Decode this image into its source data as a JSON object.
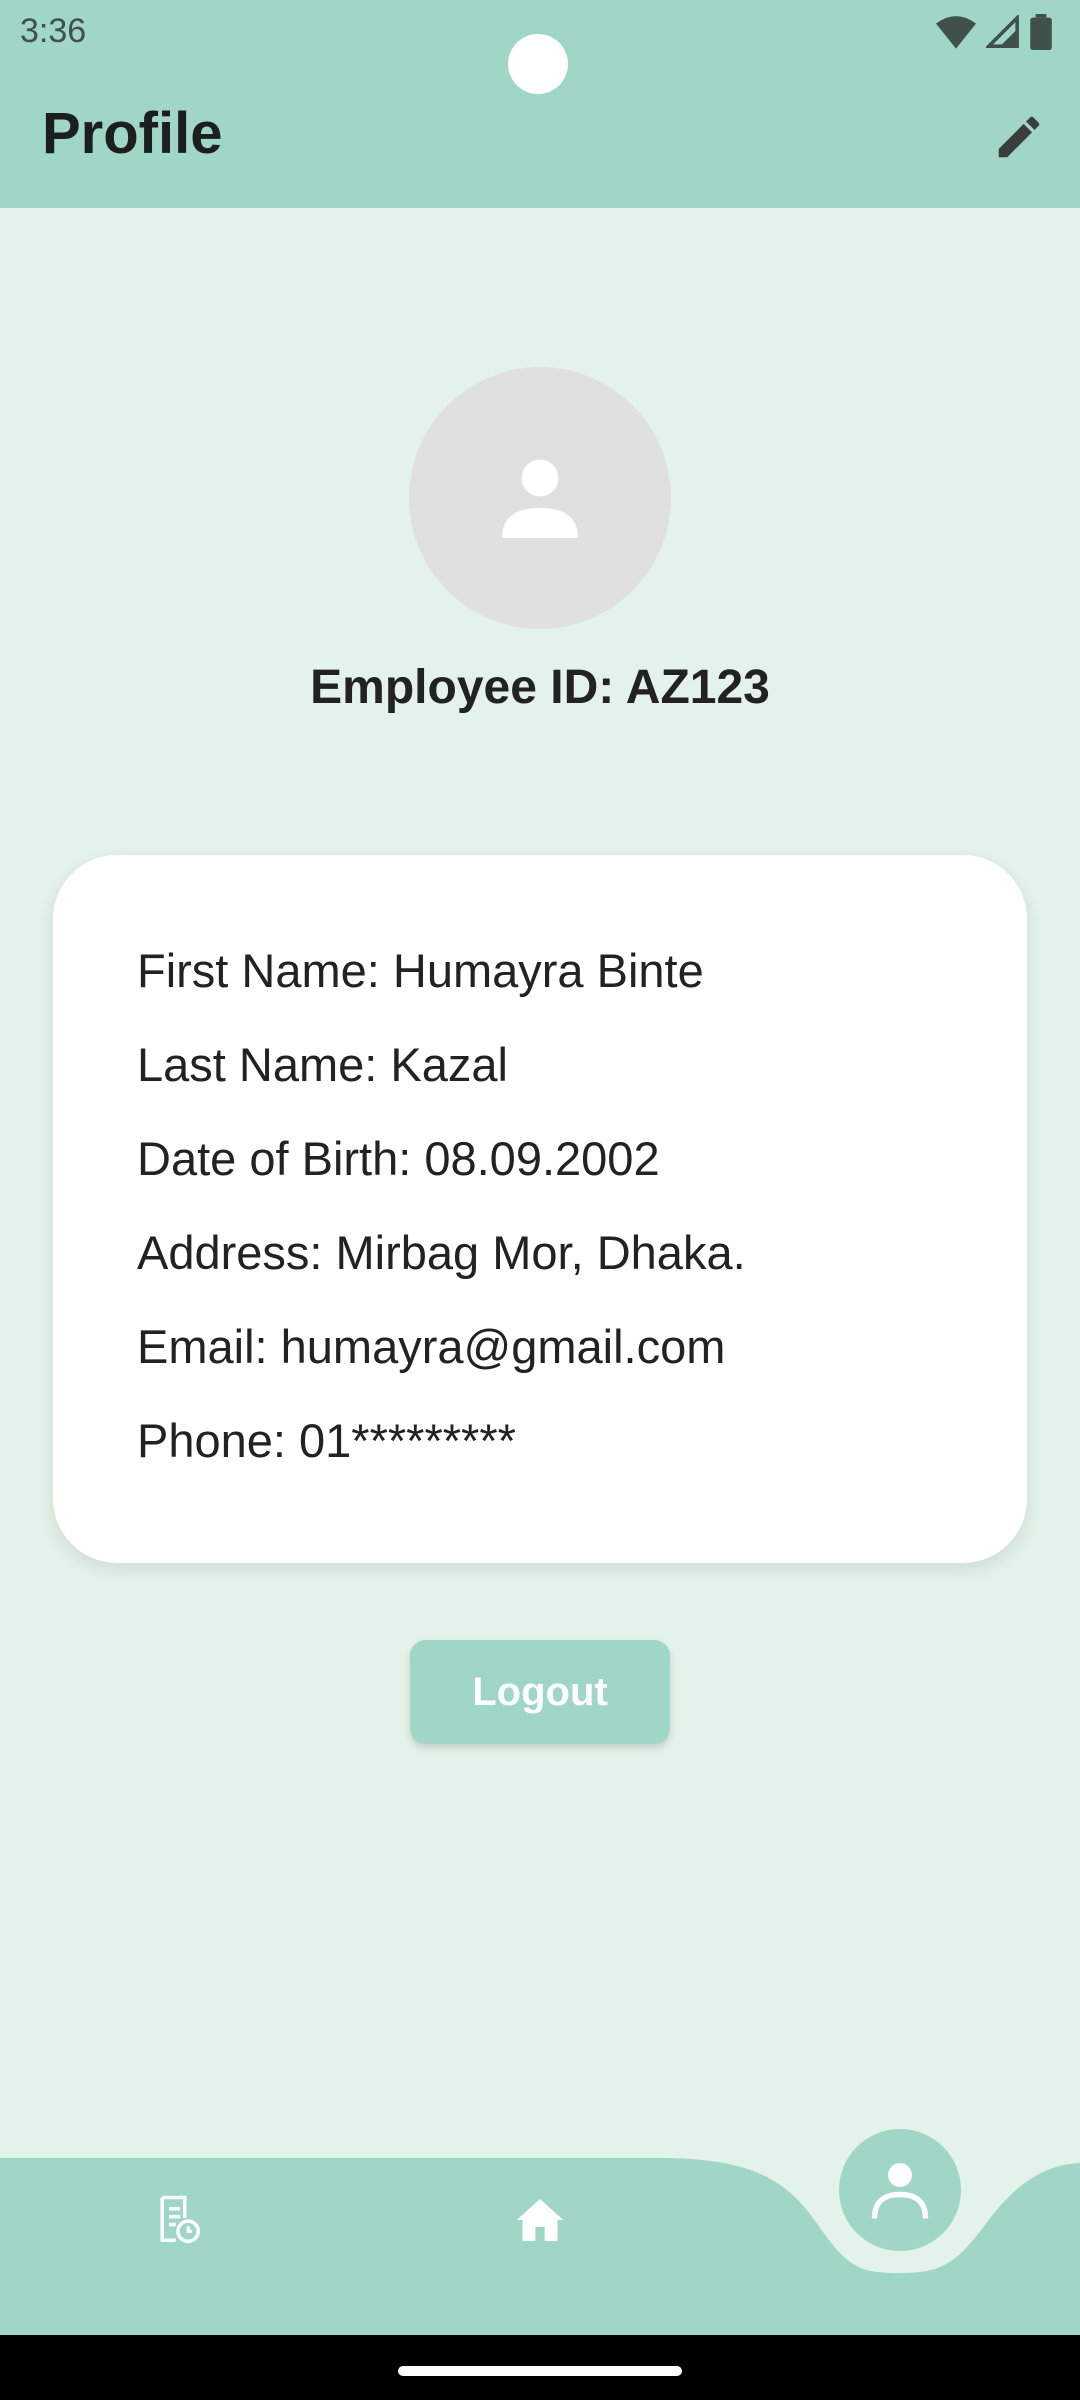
{
  "status_bar": {
    "time": "3:36"
  },
  "header": {
    "title": "Profile"
  },
  "profile": {
    "employee_id": "Employee ID: AZ123",
    "fields": [
      "First Name: Humayra Binte",
      "Last Name: Kazal",
      "Date of Birth: 08.09.2002",
      "Address: Mirbag Mor, Dhaka.",
      "Email: humayra@gmail.com",
      "Phone: 01*********"
    ]
  },
  "actions": {
    "logout_label": "Logout"
  },
  "bottom_nav": {
    "items": [
      {
        "icon": "attendance-history-icon"
      },
      {
        "icon": "home-icon"
      },
      {
        "icon": "profile-icon",
        "selected": true
      }
    ]
  },
  "colors": {
    "accent": "#9fd6c6",
    "background": "#e4f3e9",
    "card": "#ffffff"
  }
}
